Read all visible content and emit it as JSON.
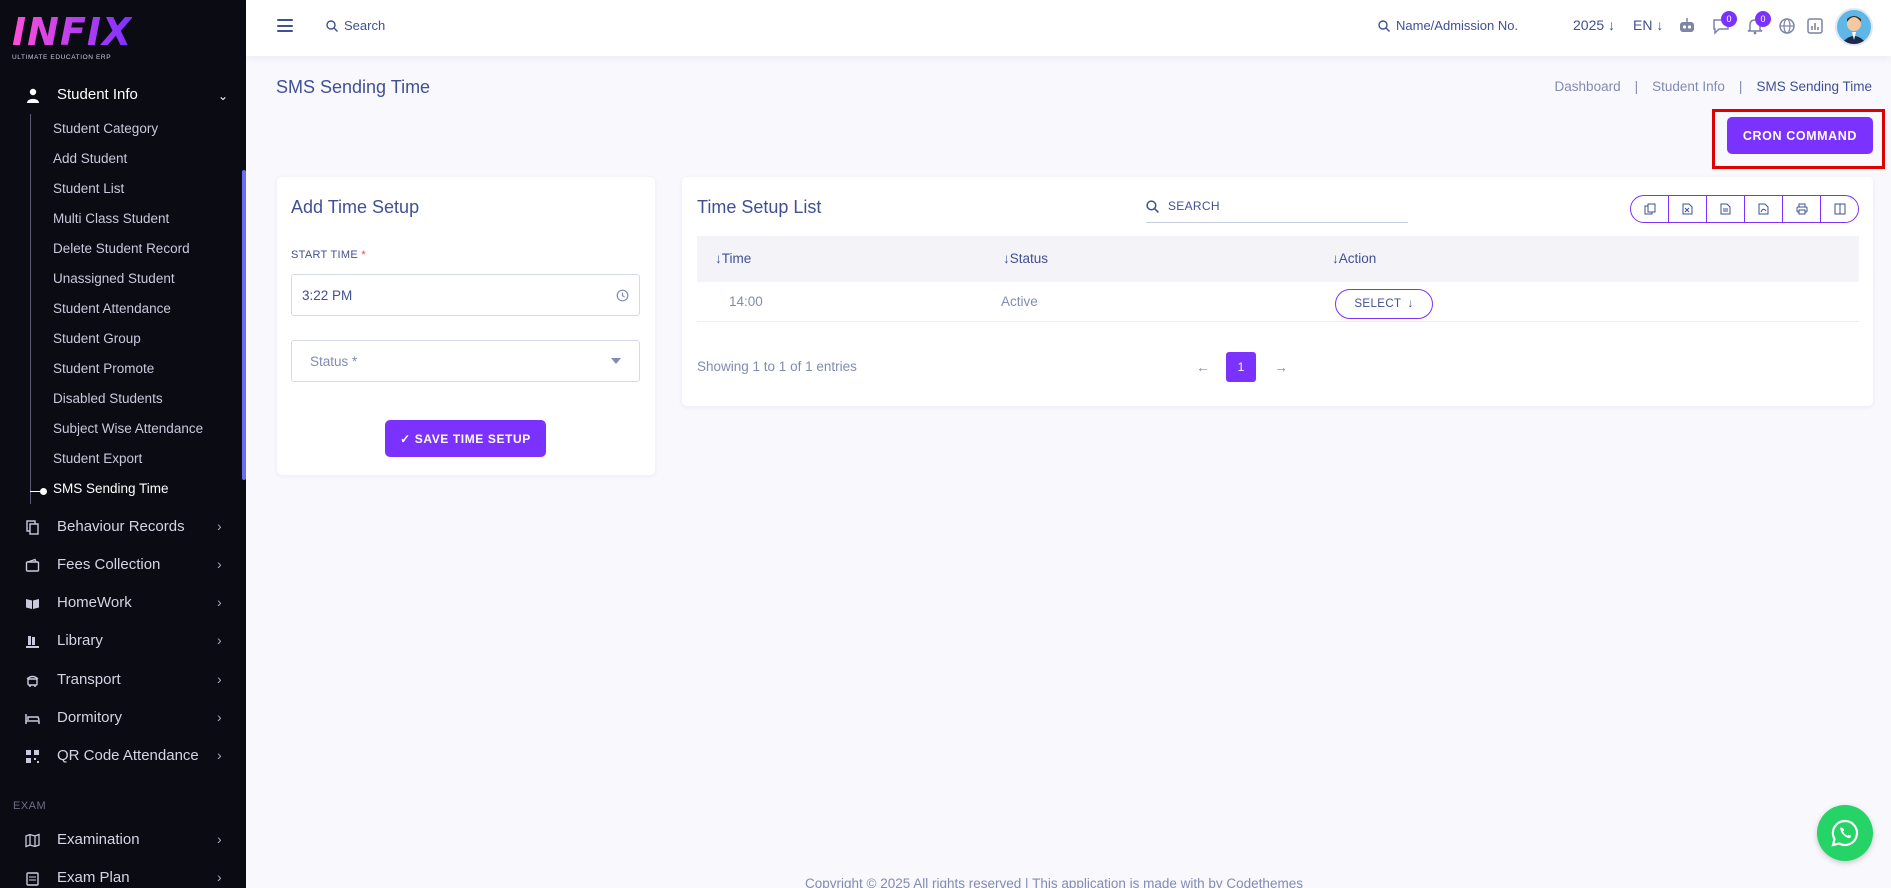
{
  "logo": {
    "mark": "INFIX",
    "tagline": "ULTIMATE EDUCATION ERP"
  },
  "sidebar": {
    "open_menu": {
      "label": "Student Info",
      "icon": "user-icon"
    },
    "sub_items": [
      "Student Category",
      "Add Student",
      "Student List",
      "Multi Class Student",
      "Delete Student Record",
      "Unassigned Student",
      "Student Attendance",
      "Student Group",
      "Student Promote",
      "Disabled Students",
      "Subject Wise Attendance",
      "Student Export",
      "SMS Sending Time"
    ],
    "active_sub": "SMS Sending Time",
    "nav_items": [
      {
        "label": "Behaviour Records",
        "icon": "files-icon"
      },
      {
        "label": "Fees Collection",
        "icon": "wallet-icon"
      },
      {
        "label": "HomeWork",
        "icon": "book-icon"
      },
      {
        "label": "Library",
        "icon": "library-icon"
      },
      {
        "label": "Transport",
        "icon": "bus-icon"
      },
      {
        "label": "Dormitory",
        "icon": "bed-icon"
      },
      {
        "label": "QR Code Attendance",
        "icon": "qr-icon"
      }
    ],
    "section_exam": "EXAM",
    "exam_items": [
      {
        "label": "Examination",
        "icon": "map-icon"
      },
      {
        "label": "Exam Plan",
        "icon": "calendar-icon"
      }
    ]
  },
  "topbar": {
    "search_label": "Search",
    "name_search_label": "Name/Admission No.",
    "year": "2025",
    "lang": "EN",
    "chat_badge": "0",
    "notif_badge": "0"
  },
  "page": {
    "title": "SMS Sending Time",
    "breadcrumb": [
      "Dashboard",
      "Student Info",
      "SMS Sending Time"
    ],
    "breadcrumb_sep": "|",
    "cron_button": "CRON COMMAND"
  },
  "add_form": {
    "title": "Add Time Setup",
    "start_time_label": "START TIME",
    "required_mark": "*",
    "start_time_value": "3:22 PM",
    "status_placeholder": "Status *",
    "save_button": "SAVE TIME SETUP"
  },
  "list": {
    "title": "Time Setup List",
    "search_placeholder": "SEARCH",
    "export_buttons": [
      "copy-icon",
      "excel-icon",
      "csv-icon",
      "pdf-icon",
      "print-icon",
      "columns-icon"
    ],
    "columns": [
      "Time",
      "Status",
      "Action"
    ],
    "rows": [
      {
        "time": "14:00",
        "status": "Active",
        "action": "SELECT"
      }
    ],
    "showing": "Showing 1 to 1 of 1 entries",
    "current_page": "1"
  },
  "footer": "Copyright © 2025 All rights reserved | This application is made with by Codethemes",
  "colors": {
    "accent": "#7c32ff",
    "sidebar_bg": "#0b0b14",
    "text": "#415094",
    "highlight": "#e00000",
    "whatsapp": "#25d366"
  }
}
